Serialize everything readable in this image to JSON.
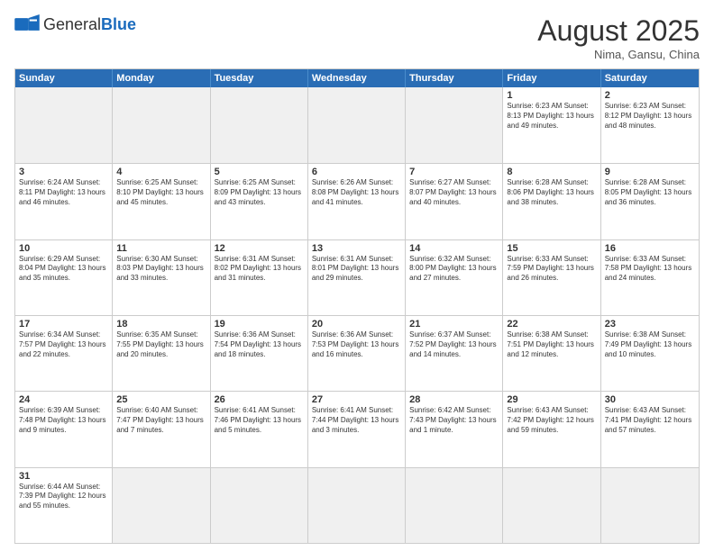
{
  "header": {
    "logo_general": "General",
    "logo_blue": "Blue",
    "title": "August 2025",
    "location": "Nima, Gansu, China"
  },
  "day_headers": [
    "Sunday",
    "Monday",
    "Tuesday",
    "Wednesday",
    "Thursday",
    "Friday",
    "Saturday"
  ],
  "weeks": [
    [
      {
        "num": "",
        "info": "",
        "empty": true
      },
      {
        "num": "",
        "info": "",
        "empty": true
      },
      {
        "num": "",
        "info": "",
        "empty": true
      },
      {
        "num": "",
        "info": "",
        "empty": true
      },
      {
        "num": "",
        "info": "",
        "empty": true
      },
      {
        "num": "1",
        "info": "Sunrise: 6:23 AM\nSunset: 8:13 PM\nDaylight: 13 hours and 49 minutes.",
        "empty": false
      },
      {
        "num": "2",
        "info": "Sunrise: 6:23 AM\nSunset: 8:12 PM\nDaylight: 13 hours and 48 minutes.",
        "empty": false
      }
    ],
    [
      {
        "num": "3",
        "info": "Sunrise: 6:24 AM\nSunset: 8:11 PM\nDaylight: 13 hours and 46 minutes.",
        "empty": false
      },
      {
        "num": "4",
        "info": "Sunrise: 6:25 AM\nSunset: 8:10 PM\nDaylight: 13 hours and 45 minutes.",
        "empty": false
      },
      {
        "num": "5",
        "info": "Sunrise: 6:25 AM\nSunset: 8:09 PM\nDaylight: 13 hours and 43 minutes.",
        "empty": false
      },
      {
        "num": "6",
        "info": "Sunrise: 6:26 AM\nSunset: 8:08 PM\nDaylight: 13 hours and 41 minutes.",
        "empty": false
      },
      {
        "num": "7",
        "info": "Sunrise: 6:27 AM\nSunset: 8:07 PM\nDaylight: 13 hours and 40 minutes.",
        "empty": false
      },
      {
        "num": "8",
        "info": "Sunrise: 6:28 AM\nSunset: 8:06 PM\nDaylight: 13 hours and 38 minutes.",
        "empty": false
      },
      {
        "num": "9",
        "info": "Sunrise: 6:28 AM\nSunset: 8:05 PM\nDaylight: 13 hours and 36 minutes.",
        "empty": false
      }
    ],
    [
      {
        "num": "10",
        "info": "Sunrise: 6:29 AM\nSunset: 8:04 PM\nDaylight: 13 hours and 35 minutes.",
        "empty": false
      },
      {
        "num": "11",
        "info": "Sunrise: 6:30 AM\nSunset: 8:03 PM\nDaylight: 13 hours and 33 minutes.",
        "empty": false
      },
      {
        "num": "12",
        "info": "Sunrise: 6:31 AM\nSunset: 8:02 PM\nDaylight: 13 hours and 31 minutes.",
        "empty": false
      },
      {
        "num": "13",
        "info": "Sunrise: 6:31 AM\nSunset: 8:01 PM\nDaylight: 13 hours and 29 minutes.",
        "empty": false
      },
      {
        "num": "14",
        "info": "Sunrise: 6:32 AM\nSunset: 8:00 PM\nDaylight: 13 hours and 27 minutes.",
        "empty": false
      },
      {
        "num": "15",
        "info": "Sunrise: 6:33 AM\nSunset: 7:59 PM\nDaylight: 13 hours and 26 minutes.",
        "empty": false
      },
      {
        "num": "16",
        "info": "Sunrise: 6:33 AM\nSunset: 7:58 PM\nDaylight: 13 hours and 24 minutes.",
        "empty": false
      }
    ],
    [
      {
        "num": "17",
        "info": "Sunrise: 6:34 AM\nSunset: 7:57 PM\nDaylight: 13 hours and 22 minutes.",
        "empty": false
      },
      {
        "num": "18",
        "info": "Sunrise: 6:35 AM\nSunset: 7:55 PM\nDaylight: 13 hours and 20 minutes.",
        "empty": false
      },
      {
        "num": "19",
        "info": "Sunrise: 6:36 AM\nSunset: 7:54 PM\nDaylight: 13 hours and 18 minutes.",
        "empty": false
      },
      {
        "num": "20",
        "info": "Sunrise: 6:36 AM\nSunset: 7:53 PM\nDaylight: 13 hours and 16 minutes.",
        "empty": false
      },
      {
        "num": "21",
        "info": "Sunrise: 6:37 AM\nSunset: 7:52 PM\nDaylight: 13 hours and 14 minutes.",
        "empty": false
      },
      {
        "num": "22",
        "info": "Sunrise: 6:38 AM\nSunset: 7:51 PM\nDaylight: 13 hours and 12 minutes.",
        "empty": false
      },
      {
        "num": "23",
        "info": "Sunrise: 6:38 AM\nSunset: 7:49 PM\nDaylight: 13 hours and 10 minutes.",
        "empty": false
      }
    ],
    [
      {
        "num": "24",
        "info": "Sunrise: 6:39 AM\nSunset: 7:48 PM\nDaylight: 13 hours and 9 minutes.",
        "empty": false
      },
      {
        "num": "25",
        "info": "Sunrise: 6:40 AM\nSunset: 7:47 PM\nDaylight: 13 hours and 7 minutes.",
        "empty": false
      },
      {
        "num": "26",
        "info": "Sunrise: 6:41 AM\nSunset: 7:46 PM\nDaylight: 13 hours and 5 minutes.",
        "empty": false
      },
      {
        "num": "27",
        "info": "Sunrise: 6:41 AM\nSunset: 7:44 PM\nDaylight: 13 hours and 3 minutes.",
        "empty": false
      },
      {
        "num": "28",
        "info": "Sunrise: 6:42 AM\nSunset: 7:43 PM\nDaylight: 13 hours and 1 minute.",
        "empty": false
      },
      {
        "num": "29",
        "info": "Sunrise: 6:43 AM\nSunset: 7:42 PM\nDaylight: 12 hours and 59 minutes.",
        "empty": false
      },
      {
        "num": "30",
        "info": "Sunrise: 6:43 AM\nSunset: 7:41 PM\nDaylight: 12 hours and 57 minutes.",
        "empty": false
      }
    ],
    [
      {
        "num": "31",
        "info": "Sunrise: 6:44 AM\nSunset: 7:39 PM\nDaylight: 12 hours and 55 minutes.",
        "empty": false
      },
      {
        "num": "",
        "info": "",
        "empty": true
      },
      {
        "num": "",
        "info": "",
        "empty": true
      },
      {
        "num": "",
        "info": "",
        "empty": true
      },
      {
        "num": "",
        "info": "",
        "empty": true
      },
      {
        "num": "",
        "info": "",
        "empty": true
      },
      {
        "num": "",
        "info": "",
        "empty": true
      }
    ]
  ]
}
